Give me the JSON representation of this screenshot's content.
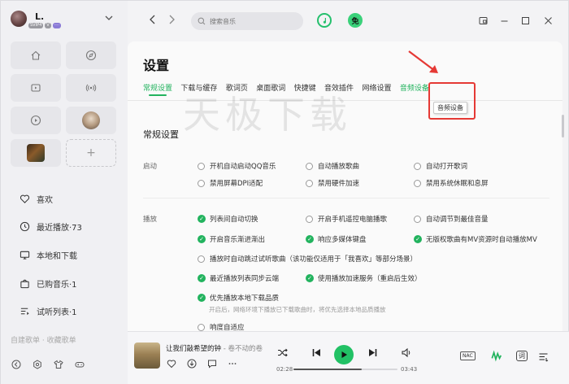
{
  "profile": {
    "name": "L.",
    "badges": [
      "SVIP4",
      "V",
      "····"
    ]
  },
  "quick_tiles": [
    {
      "icon": "home-icon"
    },
    {
      "icon": "compass-icon"
    },
    {
      "icon": "video-icon"
    },
    {
      "icon": "radio-icon"
    },
    {
      "icon": "play-circle-icon"
    },
    {
      "icon": "album-cover-avatar"
    },
    {
      "icon": "album-cover-game"
    },
    {
      "icon": "plus-icon",
      "label": "+"
    }
  ],
  "nav": [
    {
      "label": "喜欢",
      "icon": "heart-icon"
    },
    {
      "label": "最近播放·73",
      "icon": "clock-icon"
    },
    {
      "label": "本地和下载",
      "icon": "computer-icon"
    },
    {
      "label": "已购音乐·1",
      "icon": "bag-icon"
    },
    {
      "label": "试听列表·1",
      "icon": "playlist-icon"
    }
  ],
  "sidebar_fade_text": "自建歌单 · 收藏歌单",
  "search": {
    "placeholder": "搜索音乐"
  },
  "user_avatar_char": "免",
  "page": {
    "title": "设置",
    "tabs": [
      "常规设置",
      "下载与缓存",
      "歌词页",
      "桌面歌词",
      "快捷键",
      "音效插件",
      "网络设置",
      "音频设备"
    ],
    "active_tab": 0,
    "highlighted_tab": 7,
    "tooltip": "音频设备",
    "watermark": "天极下载",
    "section_title": "常规设置",
    "groups": [
      {
        "label": "启动",
        "options": [
          {
            "label": "开机自动启动QQ音乐",
            "checked": false
          },
          {
            "label": "自动播放歌曲",
            "checked": false
          },
          {
            "label": "自动打开歌词",
            "checked": false
          },
          {
            "label": "禁用屏幕DPI适配",
            "checked": false
          },
          {
            "label": "禁用硬件加速",
            "checked": false
          },
          {
            "label": "禁用系统休眠和息屏",
            "checked": false
          }
        ]
      },
      {
        "label": "播放",
        "options": [
          {
            "label": "列表间自动切换",
            "checked": true
          },
          {
            "label": "开启手机遥控电脑播歌",
            "checked": false
          },
          {
            "label": "自动调节到最佳音量",
            "checked": false
          },
          {
            "label": "开启音乐渐进渐出",
            "checked": true
          },
          {
            "label": "响应多媒体键盘",
            "checked": true
          },
          {
            "label": "无版权歌曲有MV资源时自动播放MV",
            "checked": true
          },
          {
            "label": "播放时自动跳过试听歌曲（该功能仅适用于「我喜欢」等部分场景）",
            "checked": false
          },
          {
            "label": "最近播放列表同步云端",
            "checked": true
          },
          {
            "label": "使用播放加速服务（重启后生效）",
            "checked": true
          },
          {
            "label": "优先播放本地下载品质",
            "checked": true
          },
          {
            "label": "响度自适应",
            "checked": false
          }
        ],
        "note": "开启后，网络环境下播放已下载歌曲时，将优先选择本地品质播放"
      }
    ]
  },
  "player": {
    "song_title": "让我们敲希望的钟",
    "artist": "卷不动的卷",
    "current_time": "02:28",
    "total_time": "03:43",
    "progress": 0.66,
    "nac_label": "NAC",
    "lyric_label": "词"
  },
  "colors": {
    "accent": "#22b35e",
    "annotation": "#e53935"
  }
}
